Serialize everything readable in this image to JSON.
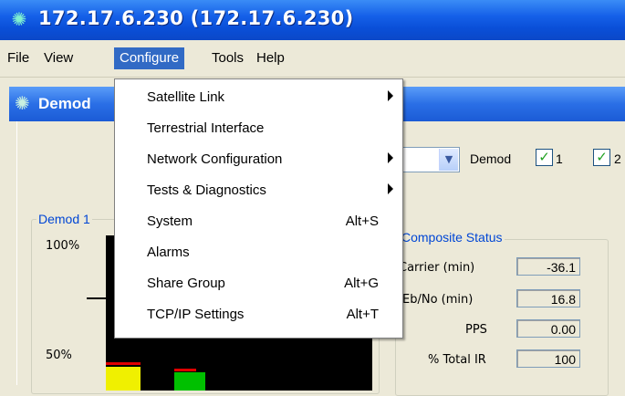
{
  "window": {
    "title": "172.17.6.230 (172.17.6.230)",
    "inner_title": "Demod"
  },
  "menubar": {
    "items": [
      "File",
      "View",
      "Configure",
      "Tools",
      "Help"
    ]
  },
  "configure_menu": {
    "items": [
      {
        "label": "Satellite Link",
        "shortcut": "",
        "submenu": true
      },
      {
        "label": "Terrestrial Interface",
        "shortcut": "",
        "submenu": false
      },
      {
        "label": "Network Configuration",
        "shortcut": "",
        "submenu": true
      },
      {
        "label": "Tests & Diagnostics",
        "shortcut": "",
        "submenu": true
      },
      {
        "label": "System",
        "shortcut": "Alt+S",
        "submenu": false
      },
      {
        "label": "Alarms",
        "shortcut": "",
        "submenu": false
      },
      {
        "label": "Share Group",
        "shortcut": "Alt+G",
        "submenu": false
      },
      {
        "label": "TCP/IP Settings",
        "shortcut": "Alt+T",
        "submenu": false
      }
    ]
  },
  "toolbar": {
    "demod_label": "Demod",
    "checkbox1_label": "1",
    "checkbox2_label": "2"
  },
  "demod_group": {
    "title": "Demod 1",
    "tick_100": "100%",
    "tick_50": "50%"
  },
  "composite_status": {
    "title": "Composite Status",
    "rows": [
      {
        "label": "Carrier (min)",
        "value": "-36.1"
      },
      {
        "label": "Eb/No (min)",
        "value": "16.8"
      },
      {
        "label": "PPS",
        "value": "0.00"
      },
      {
        "label": "% Total IR",
        "value": "100"
      }
    ]
  },
  "colors": {
    "title_bar": "#0a4fd8",
    "menu_highlight": "#316ac5",
    "group_title": "#0046d5",
    "bar_yellow": "#f0f000",
    "bar_green": "#00c000",
    "threshold_red": "#e00000"
  }
}
